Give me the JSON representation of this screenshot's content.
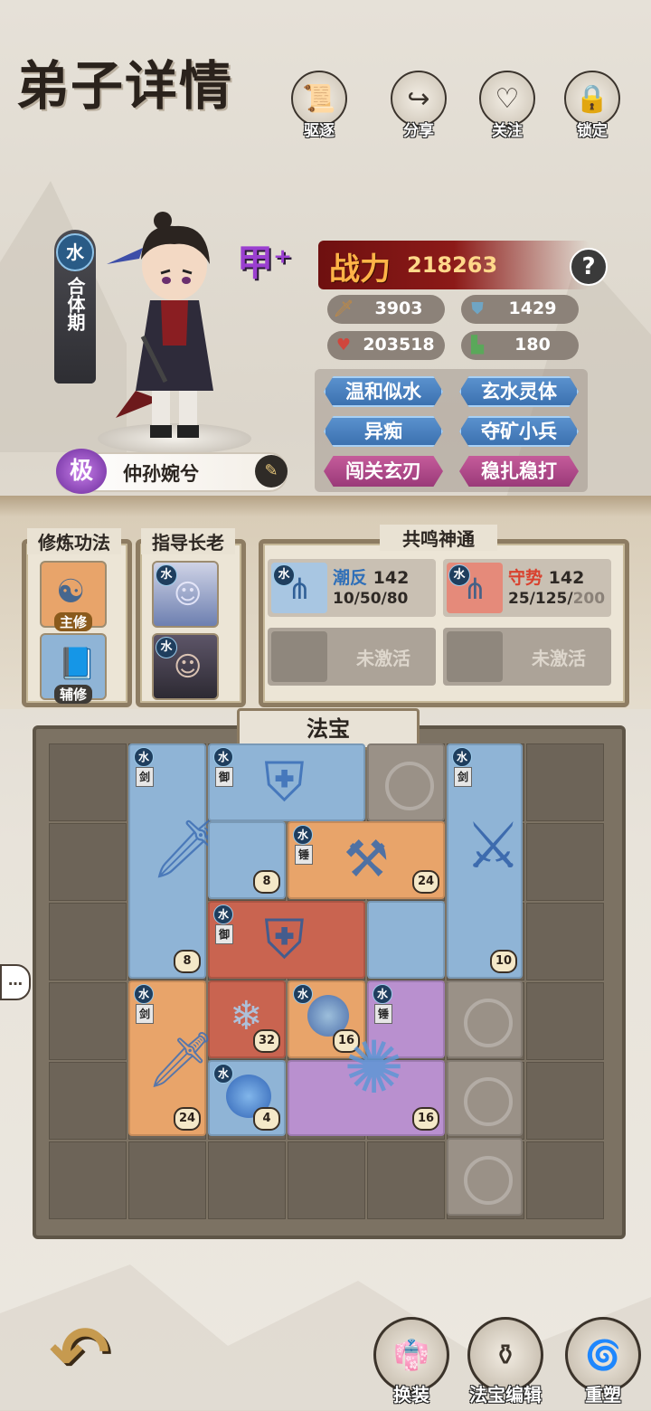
{
  "header": {
    "title": "弟子详情",
    "buttons": [
      {
        "label": "驱逐",
        "icon": "scroll-icon"
      },
      {
        "label": "分享",
        "icon": "share-arrow-icon"
      },
      {
        "label": "关注",
        "icon": "heart-icon"
      },
      {
        "label": "锁定",
        "icon": "lock-icon"
      }
    ]
  },
  "disciple": {
    "element": "水",
    "realm": "合体期",
    "grade": "甲⁺",
    "rank": "极",
    "name": "仲孙婉兮",
    "power_label": "战力",
    "power": "218263",
    "stats": {
      "attack": "3903",
      "defense": "1429",
      "hp": "203518",
      "speed": "180"
    },
    "traits": [
      {
        "label": "温和似水",
        "color": "blue"
      },
      {
        "label": "玄水灵体",
        "color": "blue"
      },
      {
        "label": "异痴",
        "color": "blue"
      },
      {
        "label": "夺矿小兵",
        "color": "blue"
      },
      {
        "label": "闯关玄刃",
        "color": "pink"
      },
      {
        "label": "稳扎稳打",
        "color": "pink"
      }
    ]
  },
  "cultivation": {
    "label": "修炼功法",
    "main_tag": "主修",
    "aux_tag": "辅修"
  },
  "elders": {
    "label": "指导长老",
    "element": "水"
  },
  "resonance": {
    "label": "共鸣神通",
    "active": [
      {
        "name": "潮反",
        "level": "142",
        "progress": "10/50/80",
        "name_color": "#2f6fb8"
      },
      {
        "name": "守势",
        "level": "142",
        "progress_a": "25/125/",
        "progress_b": "200",
        "name_color": "#d9412e"
      }
    ],
    "inactive_label": "未激活"
  },
  "fabao": {
    "label": "法宝",
    "items": [
      {
        "el": "水",
        "type": "剑",
        "lv": "8",
        "color": "blue",
        "icon": "sword-icon"
      },
      {
        "el": "水",
        "type": "御",
        "lv": "8",
        "color": "blue",
        "icon": "armor-icon"
      },
      {
        "el": "水",
        "type": "剑",
        "lv": "10",
        "color": "blue",
        "icon": "greatsword-icon"
      },
      {
        "el": "水",
        "type": "锤",
        "lv": "24",
        "color": "orange",
        "icon": "hammer-icon"
      },
      {
        "el": "水",
        "type": "御",
        "lv": "32",
        "color": "red",
        "icon": "armor-icon"
      },
      {
        "el": "水",
        "type": "剑",
        "lv": "24",
        "color": "orange",
        "icon": "sword-icon"
      },
      {
        "el": "水",
        "type": "",
        "lv": "16",
        "color": "orange",
        "icon": "orb-icon"
      },
      {
        "el": "水",
        "type": "锤",
        "lv": "16",
        "color": "purple",
        "icon": "mace-icon"
      },
      {
        "el": "水",
        "type": "",
        "lv": "4",
        "color": "blue",
        "icon": "orb-icon"
      }
    ]
  },
  "bottom": {
    "buttons": [
      {
        "label": "换装",
        "icon": "robe-icon"
      },
      {
        "label": "法宝编辑",
        "icon": "gourd-icon"
      },
      {
        "label": "重塑",
        "icon": "swirl-icon"
      }
    ]
  },
  "colors": {
    "power_bg": "#8c1a18",
    "trait_blue": "#3a6fae",
    "trait_pink": "#9a3a79",
    "grade_purple": "#9a3fd0"
  }
}
